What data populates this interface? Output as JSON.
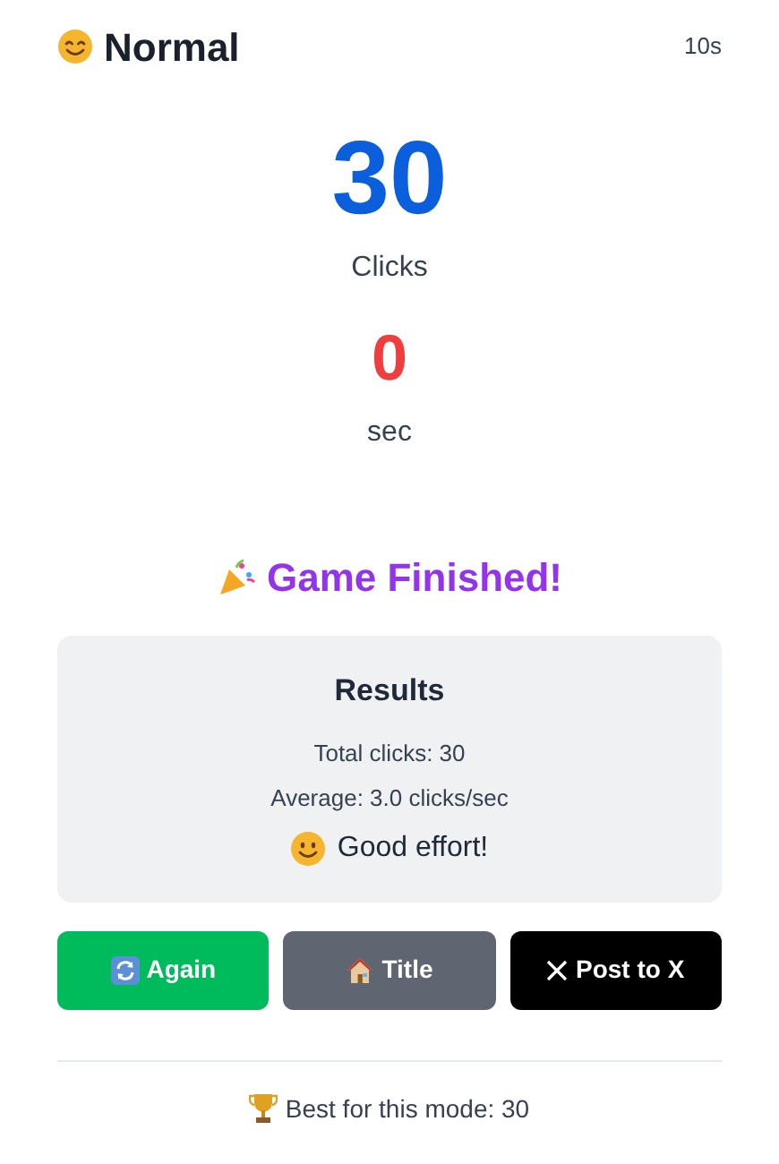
{
  "header": {
    "mode": "Normal",
    "duration": "10s"
  },
  "score": {
    "value": "30",
    "label": "Clicks"
  },
  "timer": {
    "value": "0",
    "label": "sec"
  },
  "status": "Game Finished!",
  "results": {
    "title": "Results",
    "lines": [
      "Total clicks: 30",
      "Average: 3.0 clicks/sec"
    ],
    "verdict": "Good effort!"
  },
  "buttons": [
    {
      "kind": "again",
      "label": "Again"
    },
    {
      "kind": "title",
      "label": "Title"
    },
    {
      "kind": "post",
      "label": "Post to X"
    }
  ],
  "best": "Best for this mode: 30"
}
